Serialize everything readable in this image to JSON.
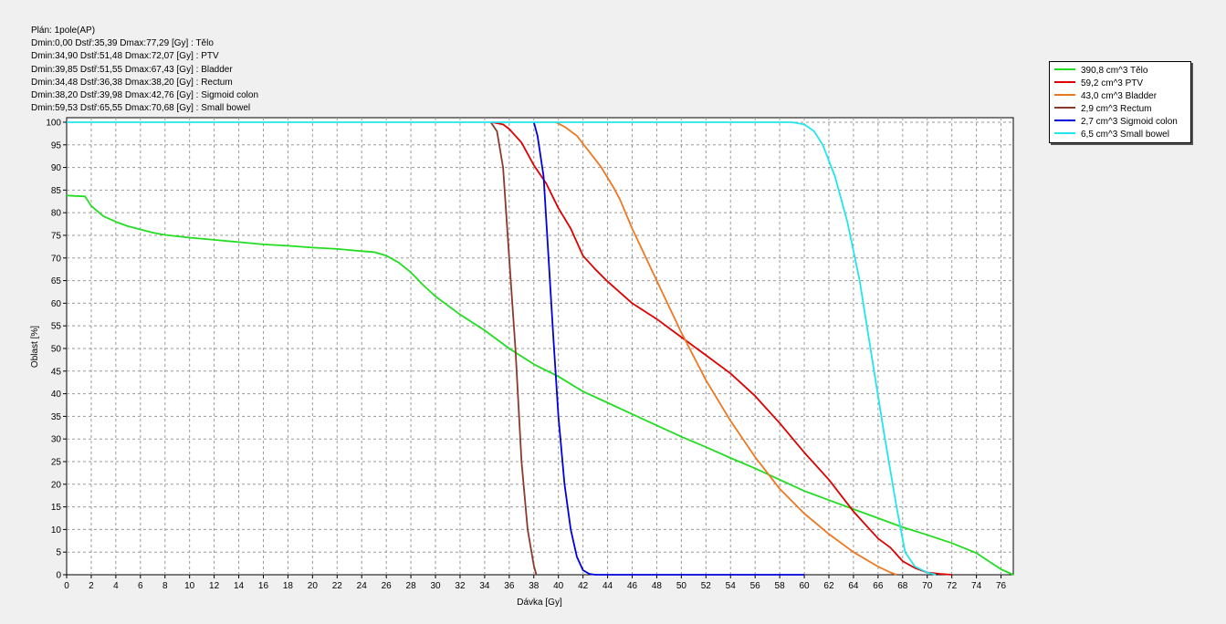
{
  "info": {
    "plan": "Plán: 1pole(AP)",
    "lines": [
      "Dmin:0,00 Dstř:35,39 Dmax:77,29 [Gy] : Tělo",
      "Dmin:34,90 Dstř:51,48 Dmax:72,07 [Gy] : PTV",
      "Dmin:39,85 Dstř:51,55 Dmax:67,43 [Gy] : Bladder",
      "Dmin:34,48 Dstř:36,38 Dmax:38,20 [Gy] : Rectum",
      "Dmin:38,20 Dstř:39,98 Dmax:42,76 [Gy] : Sigmoid colon",
      "Dmin:59,53 Dstř:65,55 Dmax:70,68 [Gy] : Small bowel"
    ]
  },
  "chart_data": {
    "type": "line",
    "xlabel": "Dávka [Gy]",
    "ylabel": "Oblast [%]",
    "xlim": [
      0,
      77
    ],
    "ylim": [
      0,
      101
    ],
    "xticks": [
      0,
      2,
      4,
      6,
      8,
      10,
      12,
      14,
      16,
      18,
      20,
      22,
      24,
      26,
      28,
      30,
      32,
      34,
      36,
      38,
      40,
      42,
      44,
      46,
      48,
      50,
      52,
      54,
      56,
      58,
      60,
      62,
      64,
      66,
      68,
      70,
      72,
      74,
      76
    ],
    "yticks": [
      0,
      5,
      10,
      15,
      20,
      25,
      30,
      35,
      40,
      45,
      50,
      55,
      60,
      65,
      70,
      75,
      80,
      85,
      90,
      95,
      100
    ],
    "grid": true,
    "legend_position": "outside-right-top",
    "series": [
      {
        "name": "390,8 cm^3 Tělo",
        "color": "#22dd22",
        "points": [
          [
            0,
            83.8
          ],
          [
            1.5,
            83.6
          ],
          [
            2,
            81.5
          ],
          [
            3,
            79.2
          ],
          [
            4,
            78
          ],
          [
            5,
            77
          ],
          [
            6,
            76.3
          ],
          [
            7,
            75.6
          ],
          [
            8,
            75.1
          ],
          [
            10,
            74.5
          ],
          [
            12,
            74
          ],
          [
            14,
            73.5
          ],
          [
            16,
            73
          ],
          [
            18,
            72.7
          ],
          [
            20,
            72.3
          ],
          [
            22,
            72
          ],
          [
            24,
            71.5
          ],
          [
            25,
            71.3
          ],
          [
            26,
            70.5
          ],
          [
            27,
            69
          ],
          [
            28,
            66.8
          ],
          [
            29,
            64
          ],
          [
            30,
            61.5
          ],
          [
            32,
            57.5
          ],
          [
            34,
            54
          ],
          [
            36,
            50
          ],
          [
            38,
            46.5
          ],
          [
            40,
            43.8
          ],
          [
            42,
            40.5
          ],
          [
            44,
            38
          ],
          [
            46,
            35.5
          ],
          [
            48,
            33
          ],
          [
            50,
            30.5
          ],
          [
            52,
            28.2
          ],
          [
            54,
            25.8
          ],
          [
            56,
            23.5
          ],
          [
            58,
            21
          ],
          [
            60,
            18.5
          ],
          [
            62,
            16.5
          ],
          [
            64,
            14.5
          ],
          [
            66,
            12.5
          ],
          [
            68,
            10.5
          ],
          [
            70,
            8.8
          ],
          [
            72,
            7
          ],
          [
            74,
            4.8
          ],
          [
            76,
            1.2
          ],
          [
            77,
            0
          ]
        ]
      },
      {
        "name": "59,2 cm^3 PTV",
        "color": "#dd0000",
        "points": [
          [
            34.6,
            100
          ],
          [
            35.5,
            99.5
          ],
          [
            36,
            98.5
          ],
          [
            37,
            95.5
          ],
          [
            38,
            90.5
          ],
          [
            39,
            86.5
          ],
          [
            40,
            81
          ],
          [
            41,
            76.5
          ],
          [
            42,
            70.5
          ],
          [
            43,
            67.5
          ],
          [
            44,
            64.8
          ],
          [
            46,
            60
          ],
          [
            48,
            56.5
          ],
          [
            50,
            52.5
          ],
          [
            52,
            48.5
          ],
          [
            54,
            44.5
          ],
          [
            56,
            39.5
          ],
          [
            58,
            33.5
          ],
          [
            60,
            27
          ],
          [
            62,
            21
          ],
          [
            64,
            14
          ],
          [
            66,
            8
          ],
          [
            67,
            6
          ],
          [
            68,
            3
          ],
          [
            69,
            1.5
          ],
          [
            70,
            0.5
          ],
          [
            71,
            0.2
          ],
          [
            72,
            0
          ]
        ]
      },
      {
        "name": "43,0 cm^3 Bladder",
        "color": "#ee7722",
        "points": [
          [
            39.8,
            100
          ],
          [
            40.5,
            99
          ],
          [
            41.5,
            97
          ],
          [
            42.5,
            93.5
          ],
          [
            43.5,
            90
          ],
          [
            44.5,
            85.5
          ],
          [
            45,
            83
          ],
          [
            46,
            76.5
          ],
          [
            48,
            65
          ],
          [
            50,
            53.5
          ],
          [
            52,
            43
          ],
          [
            54,
            34
          ],
          [
            56,
            26
          ],
          [
            58,
            19
          ],
          [
            60,
            13.5
          ],
          [
            62,
            9
          ],
          [
            64,
            5
          ],
          [
            66,
            1.8
          ],
          [
            67,
            0.5
          ],
          [
            67.5,
            0
          ]
        ]
      },
      {
        "name": "2,9 cm^3 Rectum",
        "color": "#8b3a2a",
        "points": [
          [
            34.5,
            100
          ],
          [
            35,
            98
          ],
          [
            35.5,
            90
          ],
          [
            36,
            70
          ],
          [
            36.5,
            50
          ],
          [
            37,
            25
          ],
          [
            37.5,
            10
          ],
          [
            38,
            2
          ],
          [
            38.2,
            0
          ]
        ]
      },
      {
        "name": "2,7 cm^3 Sigmoid colon",
        "color": "#0000dd",
        "points": [
          [
            38,
            100
          ],
          [
            38.3,
            97
          ],
          [
            38.8,
            88
          ],
          [
            39.2,
            70
          ],
          [
            39.6,
            52
          ],
          [
            40,
            35
          ],
          [
            40.5,
            20
          ],
          [
            41,
            10
          ],
          [
            41.5,
            4
          ],
          [
            42,
            1
          ],
          [
            42.5,
            0.2
          ],
          [
            43,
            0
          ],
          [
            60,
            0
          ]
        ]
      },
      {
        "name": "6,5 cm^3 Small bowel",
        "color": "#22e5ee",
        "points": [
          [
            0,
            100
          ],
          [
            59,
            100
          ],
          [
            60,
            99.5
          ],
          [
            60.8,
            98
          ],
          [
            61.5,
            95
          ],
          [
            62.5,
            88
          ],
          [
            63.5,
            78
          ],
          [
            64.5,
            65
          ],
          [
            65.5,
            48
          ],
          [
            66.5,
            31
          ],
          [
            67.5,
            15
          ],
          [
            68.2,
            5
          ],
          [
            69,
            1.8
          ],
          [
            70,
            0.5
          ],
          [
            70.7,
            0
          ]
        ]
      }
    ]
  }
}
